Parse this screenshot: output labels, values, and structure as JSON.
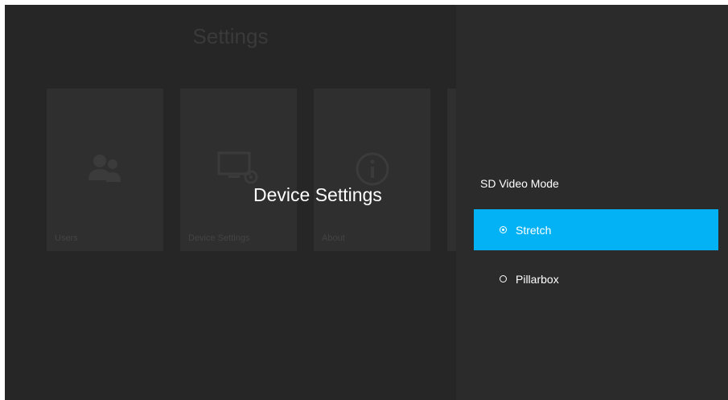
{
  "background": {
    "title": "Settings",
    "tiles": [
      {
        "label": "Users",
        "icon": "users-icon"
      },
      {
        "label": "Device Settings",
        "icon": "device-settings-icon"
      },
      {
        "label": "About",
        "icon": "info-icon"
      }
    ]
  },
  "overlay": {
    "title": "Device Settings"
  },
  "panel": {
    "heading": "SD Video Mode",
    "options": [
      {
        "label": "Stretch",
        "selected": true
      },
      {
        "label": "Pillarbox",
        "selected": false
      }
    ]
  },
  "colors": {
    "accent": "#03b2f4",
    "background": "#262626",
    "panel": "#2b2b2b"
  }
}
